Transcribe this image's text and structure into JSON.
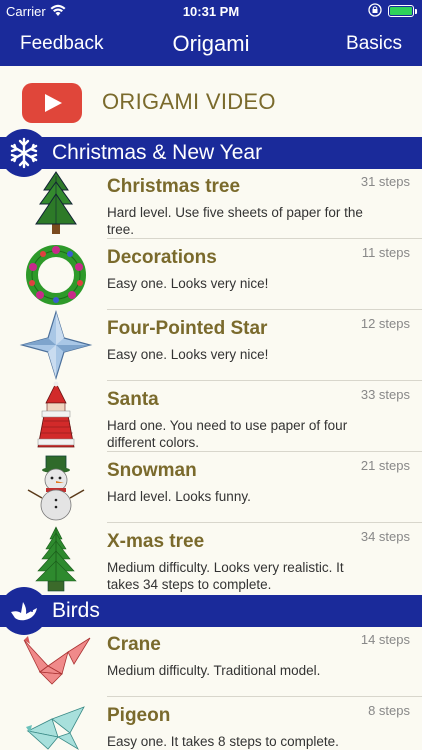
{
  "status": {
    "carrier": "Carrier",
    "time": "10:31 PM",
    "battery_level": 1.0
  },
  "nav": {
    "left": "Feedback",
    "title": "Origami",
    "right": "Basics"
  },
  "video": {
    "label": "ORIGAMI VIDEO",
    "icon": "youtube-play-icon"
  },
  "sections": [
    {
      "title": "Christmas & New Year",
      "icon": "snowflake-icon",
      "items": [
        {
          "name": "Christmas tree",
          "steps": "31 steps",
          "desc": "Hard level. Use five sheets of paper for the tree."
        },
        {
          "name": "Decorations",
          "steps": "11 steps",
          "desc": "Easy one. Looks very nice!"
        },
        {
          "name": "Four-Pointed Star",
          "steps": "12 steps",
          "desc": "Easy one. Looks very nice!"
        },
        {
          "name": "Santa",
          "steps": "33 steps",
          "desc": "Hard one. You need to use paper of four different colors."
        },
        {
          "name": "Snowman",
          "steps": "21 steps",
          "desc": "Hard level. Looks funny."
        },
        {
          "name": "X-mas tree",
          "steps": "34 steps",
          "desc": "Medium difficulty. Looks very realistic. It takes 34 steps to complete."
        }
      ]
    },
    {
      "title": "Birds",
      "icon": "bird-icon",
      "items": [
        {
          "name": "Crane",
          "steps": "14 steps",
          "desc": "Medium difficulty. Traditional model."
        },
        {
          "name": "Pigeon",
          "steps": "8 steps",
          "desc": "Easy one. It takes 8 steps to complete."
        }
      ]
    }
  ],
  "colors": {
    "nav_bg": "#1a2a9a",
    "title_text": "#7a6a2c",
    "background": "#fbfaf2",
    "youtube_red": "#e0463a"
  }
}
